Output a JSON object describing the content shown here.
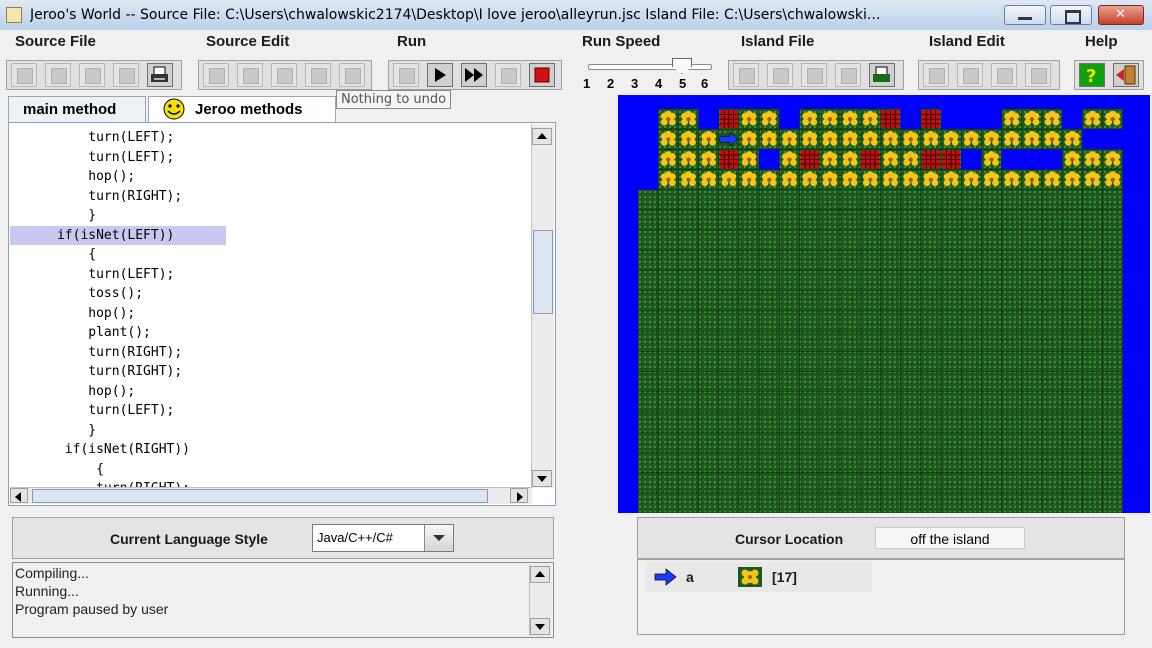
{
  "window": {
    "title": "Jeroo's World -- Source File: C:\\Users\\chwalowskic2174\\Desktop\\I love jeroo\\alleyrun.jsc     Island File: C:\\Users\\chwalowski..."
  },
  "menu": {
    "source_file": "Source File",
    "source_edit": "Source Edit",
    "run": "Run",
    "run_speed": "Run Speed",
    "island_file": "Island File",
    "island_edit": "Island Edit",
    "help": "Help"
  },
  "toolbar": {
    "tooltip": "Nothing to undo",
    "speed_ticks": [
      "1",
      "2",
      "3",
      "4",
      "5",
      "6"
    ],
    "speed_value": 5
  },
  "tabs": {
    "main_method": "main method",
    "jeroo_methods": "Jeroo methods"
  },
  "editor": {
    "highlighted_line": 5,
    "lines": [
      "          turn(LEFT);",
      "          turn(LEFT);",
      "          hop();",
      "          turn(RIGHT);",
      "          }",
      "      if(isNet(LEFT))",
      "          {",
      "          turn(LEFT);",
      "          toss();",
      "          hop();",
      "          plant();",
      "          turn(RIGHT);",
      "          turn(RIGHT);",
      "          hop();",
      "          turn(LEFT);",
      "          }",
      "       if(isNet(RIGHT))",
      "           {",
      "           turn(RIGHT);"
    ]
  },
  "language": {
    "label": "Current Language Style",
    "selected": "Java/C++/C#"
  },
  "console": {
    "lines": [
      "Compiling...",
      "Running...",
      "Program paused by user"
    ]
  },
  "cursor": {
    "label": "Cursor Location",
    "value": "off the island"
  },
  "legend": {
    "jeroo_name": "a",
    "flower_count": "[17]"
  },
  "island": {
    "rows": 24,
    "cols": 24,
    "colors": {
      "water": "#0000ff",
      "grass": "#1e5a1e",
      "flower": "#f5c518",
      "net": "#c01010",
      "jeroo": "#1a3cff"
    },
    "cells": [
      "wffwNffwffffNwNwwwfffwff",
      "wfffJfffffffffffffffffww",
      "wfffNFwFNFFNFFNNwfwwwfff",
      "wfffffffffffffffffffffff"
    ]
  },
  "icons": {
    "toolbar_left": [
      "new-file-icon",
      "open-file-icon",
      "save-icon",
      "save-as-icon",
      "print-icon",
      "cut-icon",
      "copy-icon",
      "paste-icon",
      "undo-icon",
      "redo-icon"
    ],
    "run_controls": [
      "reset-icon",
      "step-icon",
      "run-icon",
      "pause-icon",
      "stop-icon"
    ],
    "toolbar_right": [
      "new-island-icon",
      "open-island-icon",
      "save-island-icon",
      "save-island-as-icon",
      "print-island-icon",
      "clear-island-icon",
      "grid-icon",
      "water-icon",
      "grass-icon",
      "help-icon",
      "exit-icon"
    ]
  }
}
